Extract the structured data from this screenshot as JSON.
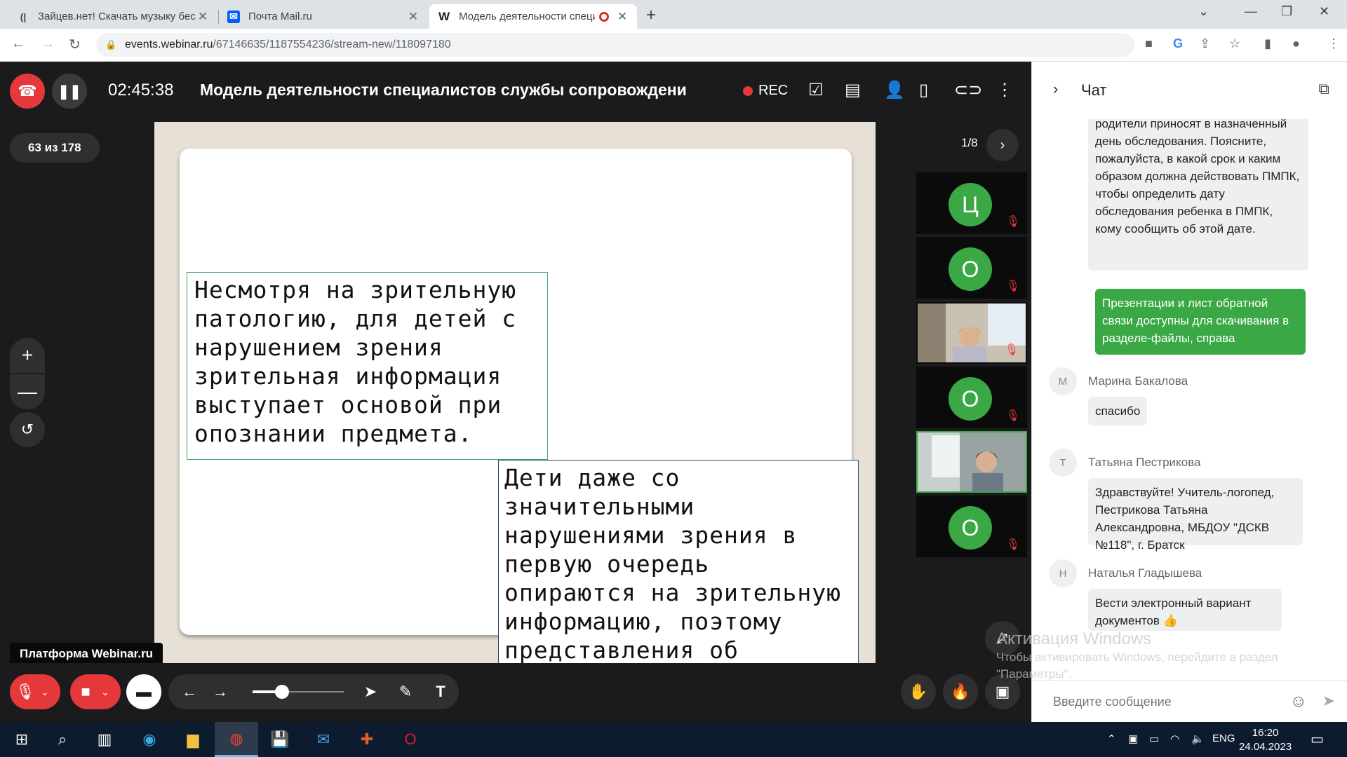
{
  "browser": {
    "tabs": [
      {
        "title": "Зайцев.нет! Скачать музыку бес",
        "favicon": "zaycev-icon"
      },
      {
        "title": "Почта Mail.ru",
        "favicon": "mail-icon"
      },
      {
        "title": "Модель деятельности специ",
        "favicon": "webinar-w-icon",
        "active": true,
        "recording": true
      }
    ],
    "url_host": "events.webinar.ru",
    "url_path": "/67146635/1187554236/stream-new/118097180"
  },
  "webinar": {
    "timer": "02:45:38",
    "title": "Модель деятельности специалистов службы сопровождени",
    "rec_label": "REC",
    "slide_counter": "63 из 178",
    "platform_label": "Платформа Webinar.ru",
    "participants_pager": "1/8",
    "slide": {
      "text1": "Несмотря на зрительную патологию, для детей с нарушением зрения зрительная информация выступает основой при опознании предмета.",
      "text2": "Дети даже со значительными нарушениями зрения в первую очередь опираются на зрительную информацию, поэтому представления об окружающем мире у них бедны и искажены."
    },
    "participants": [
      {
        "initial": "Ц",
        "type": "avatar"
      },
      {
        "initial": "О",
        "type": "avatar"
      },
      {
        "type": "camera"
      },
      {
        "initial": "О",
        "type": "avatar"
      },
      {
        "type": "camera",
        "active": true
      },
      {
        "initial": "О",
        "type": "avatar"
      }
    ],
    "colors": {
      "accent_green": "#3aa845",
      "danger_red": "#e5383b",
      "bg_dark": "#1b1b1d"
    }
  },
  "chat": {
    "title": "Чат",
    "messages": [
      {
        "text": "родители приносят в назначенный день обследования. Поясните, пожалуйста, в какой срок и каким образом должна действовать ПМПК, чтобы определить дату обследования ребенка в ПМПК, кому сообщить об этой дате."
      },
      {
        "text": "Презентации и лист обратной связи доступны для скачивания в разделе-файлы, справа",
        "mine": true
      },
      {
        "sender": "Марина Бакалова",
        "initial": "М",
        "text": "спасибо"
      },
      {
        "sender": "Татьяна Пестрикова",
        "initial": "Т",
        "text": "Здравствуйте! Учитель-логопед, Пестрикова Татьяна Александровна, МБДОУ \"ДСКВ №118\", г. Братск"
      },
      {
        "sender": "Наталья Гладышева",
        "initial": "Н",
        "text": "Вести электронный вариант документов 👍"
      }
    ],
    "input_placeholder": "Введите сообщение"
  },
  "windows": {
    "activation_title": "Активация Windows",
    "activation_text": "Чтобы активировать Windows, перейдите в раздел \"Параметры\".",
    "lang": "ENG",
    "time": "16:20",
    "date": "24.04.2023"
  }
}
